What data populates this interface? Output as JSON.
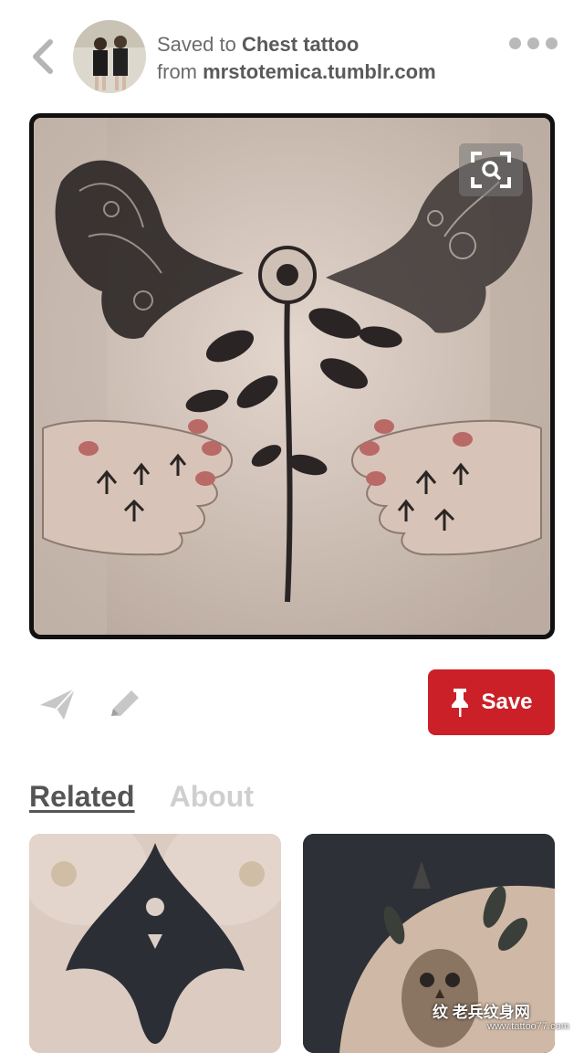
{
  "header": {
    "saved_prefix": "Saved to",
    "board_name": "Chest tattoo",
    "from_prefix": "from",
    "source_domain": "mrstotemica.tumblr.com"
  },
  "pin": {
    "image_alt": "Chest tattoo with moths and flower"
  },
  "actions": {
    "save_label": "Save"
  },
  "tabs": [
    {
      "label": "Related",
      "active": true
    },
    {
      "label": "About",
      "active": false
    }
  ],
  "watermark": {
    "text": "纹 老兵纹身网",
    "url": "www.tattoo77.com"
  },
  "colors": {
    "save_red": "#cb2027",
    "icon_gray": "#b9b9b9",
    "inactive_tab": "#cfcfcf"
  }
}
